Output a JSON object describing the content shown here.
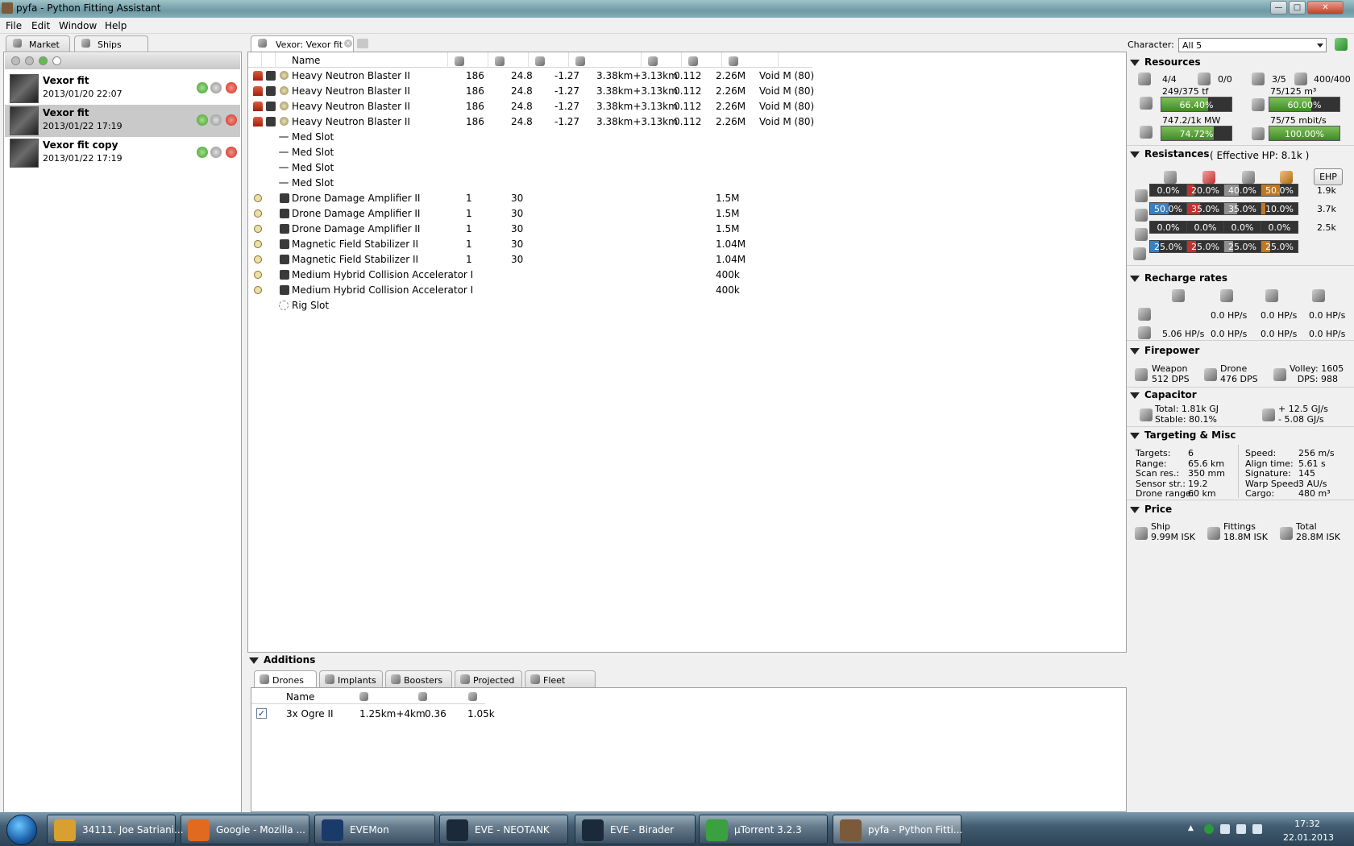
{
  "window": {
    "title": "pyfa - Python Fitting Assistant"
  },
  "menu": [
    "File",
    "Edit",
    "Window",
    "Help"
  ],
  "left": {
    "tabs": [
      {
        "label": "Market",
        "icon": "market-icon"
      },
      {
        "label": "Ships",
        "icon": "ships-icon"
      }
    ],
    "ships": [
      {
        "name": "Vexor fit",
        "date": "2013/01/20 22:07"
      },
      {
        "name": "Vexor fit",
        "date": "2013/01/22 17:19"
      },
      {
        "name": "Vexor fit copy",
        "date": "2013/01/22 17:19"
      }
    ]
  },
  "fitting": {
    "tab_label": "Vexor: Vexor fit",
    "header": {
      "name": "Name"
    },
    "rows": [
      {
        "name": "Heavy Neutron Blaster II",
        "c1": "186",
        "c2": "24.8",
        "c3": "-1.27",
        "range": "3.38km+3.13km",
        "c5": "0.112",
        "price": "2.26M",
        "ammo": "Void M (80)",
        "kind": "weapon"
      },
      {
        "name": "Heavy Neutron Blaster II",
        "c1": "186",
        "c2": "24.8",
        "c3": "-1.27",
        "range": "3.38km+3.13km",
        "c5": "0.112",
        "price": "2.26M",
        "ammo": "Void M (80)",
        "kind": "weapon"
      },
      {
        "name": "Heavy Neutron Blaster II",
        "c1": "186",
        "c2": "24.8",
        "c3": "-1.27",
        "range": "3.38km+3.13km",
        "c5": "0.112",
        "price": "2.26M",
        "ammo": "Void M (80)",
        "kind": "weapon"
      },
      {
        "name": "Heavy Neutron Blaster II",
        "c1": "186",
        "c2": "24.8",
        "c3": "-1.27",
        "range": "3.38km+3.13km",
        "c5": "0.112",
        "price": "2.26M",
        "ammo": "Void M (80)",
        "kind": "weapon"
      },
      {
        "name": "Med Slot",
        "kind": "empty"
      },
      {
        "name": "Med Slot",
        "kind": "empty"
      },
      {
        "name": "Med Slot",
        "kind": "empty"
      },
      {
        "name": "Med Slot",
        "kind": "empty"
      },
      {
        "name": "Drone Damage Amplifier II",
        "c1": "1",
        "c2": "30",
        "price": "1.5M",
        "kind": "module"
      },
      {
        "name": "Drone Damage Amplifier II",
        "c1": "1",
        "c2": "30",
        "price": "1.5M",
        "kind": "module"
      },
      {
        "name": "Drone Damage Amplifier II",
        "c1": "1",
        "c2": "30",
        "price": "1.5M",
        "kind": "module"
      },
      {
        "name": "Magnetic Field Stabilizer II",
        "c1": "1",
        "c2": "30",
        "price": "1.04M",
        "kind": "module"
      },
      {
        "name": "Magnetic Field Stabilizer II",
        "c1": "1",
        "c2": "30",
        "price": "1.04M",
        "kind": "module"
      },
      {
        "name": "Medium Hybrid Collision Accelerator I",
        "price": "400k",
        "kind": "rig"
      },
      {
        "name": "Medium Hybrid Collision Accelerator I",
        "price": "400k",
        "kind": "rig"
      },
      {
        "name": "Rig Slot",
        "kind": "emptyrig"
      }
    ]
  },
  "additions": {
    "title": "Additions",
    "tabs": [
      "Drones",
      "Implants",
      "Boosters",
      "Projected",
      "Fleet"
    ],
    "drone_header": {
      "name": "Name"
    },
    "drones": [
      {
        "name": "3x Ogre II",
        "range": "1.25km+4km",
        "c2": "0.36",
        "c3": "1.05k",
        "checked": "✓"
      }
    ]
  },
  "stats": {
    "character_label": "Character:",
    "character_value": "All 5",
    "resources": {
      "title": "Resources",
      "hardpoints": [
        "4/4",
        "0/0",
        "3/5",
        "400/400"
      ],
      "cpu_top": "249/375 tf",
      "cpu_pct": "66.40%",
      "cpu_fill": 66.4,
      "drone_bay": "75/125 m³",
      "bay_pct": "60.00%",
      "bay_fill": 60,
      "pg_top": "747.2/1k MW",
      "pg_pct": "74.72%",
      "pg_fill": 74.72,
      "bw_top": "75/75 mbit/s",
      "bw_pct": "100.00%",
      "bw_fill": 100
    },
    "resistances": {
      "title": "Resistances",
      "ehp_note": "( Effective HP: 8.1k )",
      "ehp_button": "EHP",
      "rows": [
        {
          "vals": [
            "0.0%",
            "20.0%",
            "40.0%",
            "50.0%"
          ],
          "fills": [
            0,
            20,
            40,
            50
          ],
          "hp": "1.9k"
        },
        {
          "vals": [
            "50.0%",
            "35.0%",
            "35.0%",
            "10.0%"
          ],
          "fills": [
            50,
            35,
            35,
            10
          ],
          "hp": "3.7k"
        },
        {
          "vals": [
            "0.0%",
            "0.0%",
            "0.0%",
            "0.0%"
          ],
          "fills": [
            0,
            0,
            0,
            0
          ],
          "hp": "2.5k"
        },
        {
          "vals": [
            "25.0%",
            "25.0%",
            "25.0%",
            "25.0%"
          ],
          "fills": [
            25,
            25,
            25,
            25
          ],
          "hp": ""
        }
      ],
      "colors": [
        "#3a7fc0",
        "#c23030",
        "#909090",
        "#c07820"
      ]
    },
    "recharge": {
      "title": "Recharge rates",
      "row1": [
        "0.0 HP/s",
        "0.0 HP/s",
        "0.0 HP/s"
      ],
      "row2": [
        "5.06 HP/s",
        "0.0 HP/s",
        "0.0 HP/s",
        "0.0 HP/s"
      ]
    },
    "firepower": {
      "title": "Firepower",
      "weapon_label": "Weapon",
      "weapon_dps": "512 DPS",
      "drone_label": "Drone",
      "drone_dps": "476 DPS",
      "volley": "Volley: 1605",
      "dps": "DPS: 988"
    },
    "capacitor": {
      "title": "Capacitor",
      "total": "Total: 1.81k GJ",
      "stable": "Stable: 80.1%",
      "plus": "+ 12.5 GJ/s",
      "minus": "- 5.08 GJ/s"
    },
    "targeting": {
      "title": "Targeting & Misc",
      "left": [
        [
          "Targets:",
          "6"
        ],
        [
          "Range:",
          "65.6 km"
        ],
        [
          "Scan res.:",
          "350 mm"
        ],
        [
          "Sensor str.:",
          "19.2"
        ],
        [
          "Drone range:",
          "60 km"
        ]
      ],
      "right": [
        [
          "Speed:",
          "256 m/s"
        ],
        [
          "Align time:",
          "5.61 s"
        ],
        [
          "Signature:",
          "145"
        ],
        [
          "Warp Speed:",
          "3 AU/s"
        ],
        [
          "Cargo:",
          "480 m³"
        ]
      ]
    },
    "price": {
      "title": "Price",
      "ship_label": "Ship",
      "ship_val": "9.99M ISK",
      "fit_label": "Fittings",
      "fit_val": "18.8M ISK",
      "total_label": "Total",
      "total_val": "28.8M ISK"
    }
  },
  "taskbar": {
    "items": [
      {
        "label": "34111. Joe Satriani...",
        "color": "#d8a030"
      },
      {
        "label": "Google - Mozilla ...",
        "color": "#e06a20"
      },
      {
        "label": "EVEMon",
        "color": "#1a3a6a"
      },
      {
        "label": "EVE - NEOTANK",
        "color": "#1a2a3a"
      },
      {
        "label": "EVE - Birader",
        "color": "#1a2a3a"
      },
      {
        "label": "µTorrent 3.2.3",
        "color": "#3aa040"
      },
      {
        "label": "pyfa - Python Fitti...",
        "color": "#7a5a3a"
      }
    ],
    "time": "17:32",
    "date": "22.01.2013"
  }
}
